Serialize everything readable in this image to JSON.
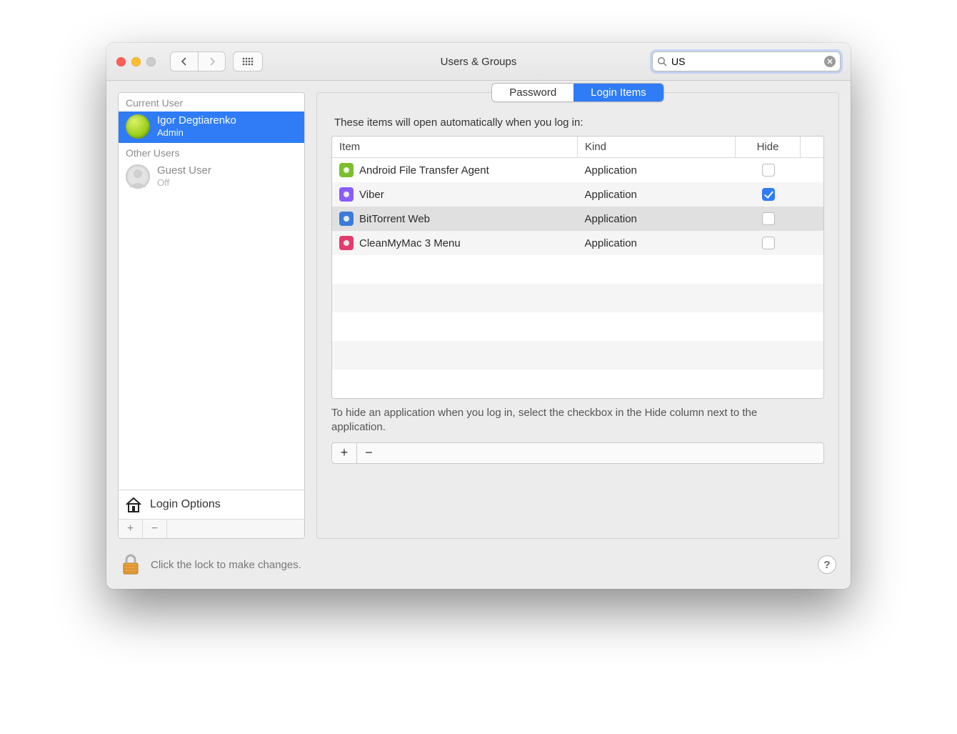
{
  "window": {
    "title": "Users & Groups"
  },
  "search": {
    "value": "US"
  },
  "sidebar": {
    "current_label": "Current User",
    "other_label": "Other Users",
    "users": [
      {
        "name": "Igor Degtiarenko",
        "role": "Admin",
        "selected": true,
        "guest": false
      },
      {
        "name": "Guest User",
        "role": "Off",
        "selected": false,
        "guest": true
      }
    ],
    "login_options": "Login Options"
  },
  "tabs": {
    "password": "Password",
    "login_items": "Login Items",
    "active": "login_items"
  },
  "main": {
    "heading": "These items will open automatically when you log in:",
    "columns": {
      "item": "Item",
      "kind": "Kind",
      "hide": "Hide"
    },
    "rows": [
      {
        "name": "Android File Transfer Agent",
        "kind": "Application",
        "hide": false,
        "selected": false,
        "icon_bg": "#7bbf2e"
      },
      {
        "name": "Viber",
        "kind": "Application",
        "hide": true,
        "selected": false,
        "icon_bg": "#8a5cf6"
      },
      {
        "name": "BitTorrent Web",
        "kind": "Application",
        "hide": false,
        "selected": true,
        "icon_bg": "#3a7cd8"
      },
      {
        "name": "CleanMyMac 3 Menu",
        "kind": "Application",
        "hide": false,
        "selected": false,
        "icon_bg": "#e23d6d"
      }
    ],
    "note": "To hide an application when you log in, select the checkbox in the Hide column next to the application."
  },
  "footer": {
    "lock_text": "Click the lock to make changes."
  }
}
